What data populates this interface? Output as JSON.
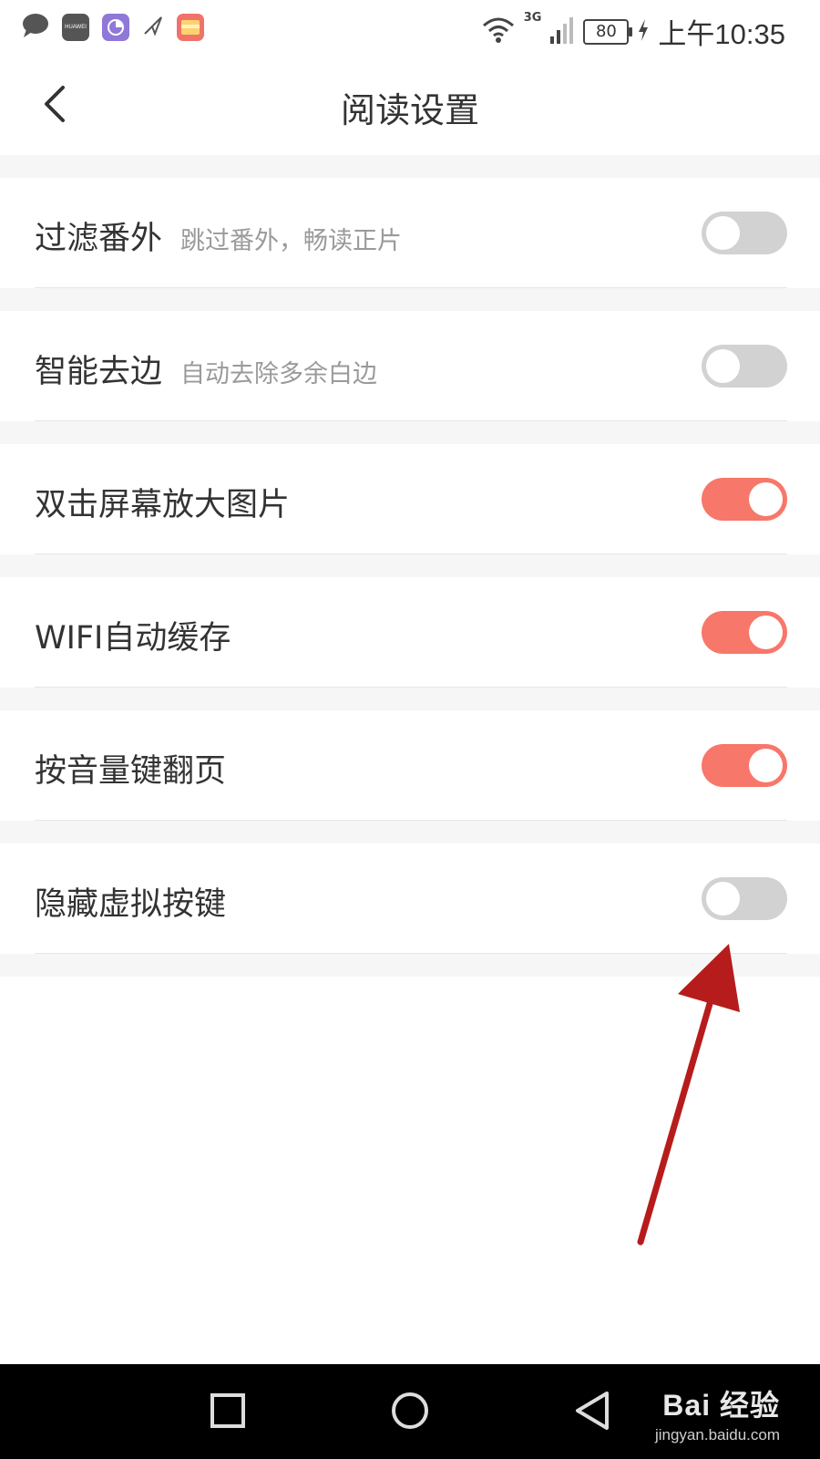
{
  "status_bar": {
    "app_icons": [
      "message-icon",
      "huawei-store-icon",
      "pie-app-icon",
      "send-icon",
      "wallet-app-icon"
    ],
    "huawei_label": "HUAWEI",
    "network": "3G",
    "battery": "80",
    "time": "上午10:35"
  },
  "header": {
    "title": "阅读设置"
  },
  "settings": [
    {
      "title": "过滤番外",
      "subtitle": "跳过番外，畅读正片",
      "enabled": false
    },
    {
      "title": "智能去边",
      "subtitle": "自动去除多余白边",
      "enabled": false
    },
    {
      "title": "双击屏幕放大图片",
      "subtitle": "",
      "enabled": true
    },
    {
      "title": "WIFI自动缓存",
      "subtitle": "",
      "enabled": true
    },
    {
      "title": "按音量键翻页",
      "subtitle": "",
      "enabled": true
    },
    {
      "title": "隐藏虚拟按键",
      "subtitle": "",
      "enabled": false
    }
  ],
  "watermark": {
    "main": "Bai 经验",
    "sub": "jingyan.baidu.com"
  },
  "colors": {
    "toggle_on": "#f7776a",
    "toggle_off": "#d2d2d2",
    "annotation_arrow": "#b71c1c"
  }
}
